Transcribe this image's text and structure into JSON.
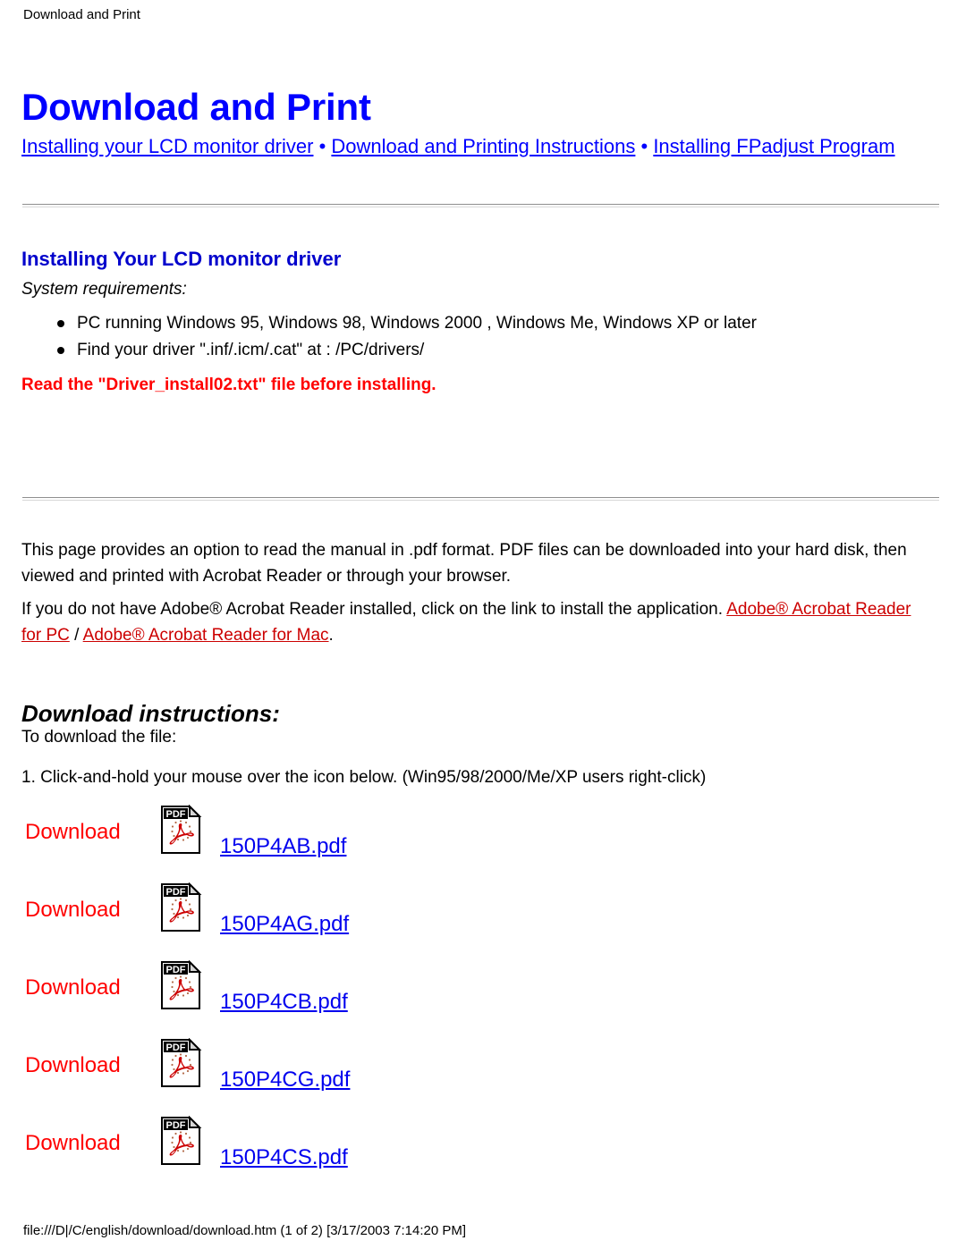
{
  "window": {
    "breadcrumb": "Download and Print"
  },
  "header": {
    "title": "Download and Print",
    "nav": {
      "link1": "Installing your LCD monitor driver",
      "sep1": " • ",
      "link2": "Download and Printing Instructions",
      "sep2": " • ",
      "link3": "Installing FPadjust Program"
    }
  },
  "driver_section": {
    "heading": "Installing Your LCD monitor driver",
    "sysreq_label": "System requirements:",
    "bullets": [
      "PC running Windows 95, Windows 98, Windows 2000 , Windows Me, Windows XP or later",
      "Find your driver \".inf/.icm/.cat\" at : /PC/drivers/"
    ],
    "warning": "Read the \"Driver_install02.txt\" file before installing."
  },
  "pdf_section": {
    "paragraph1": "This page provides an option to read the manual in .pdf format. PDF files can be downloaded into your hard disk, then viewed and printed with Acrobat Reader or through your browser.",
    "paragraph2_prefix": "If you do not have Adobe® Acrobat Reader installed, click on the link to install the application. ",
    "link_pc": "Adobe® Acrobat Reader for PC",
    "paragraph2_mid": " / ",
    "link_mac": "Adobe® Acrobat Reader for Mac",
    "paragraph2_suffix": "."
  },
  "download_section": {
    "heading": "Download instructions:",
    "subtitle": "To download the file:",
    "step1": "1. Click-and-hold your mouse over the icon below. (Win95/98/2000/Me/XP users right-click)",
    "rows": [
      {
        "label": "Download",
        "icon": "pdf-file-icon",
        "file": "150P4AB.pdf"
      },
      {
        "label": "Download",
        "icon": "pdf-file-icon",
        "file": "150P4AG.pdf"
      },
      {
        "label": "Download",
        "icon": "pdf-file-icon",
        "file": "150P4CB.pdf"
      },
      {
        "label": "Download",
        "icon": "pdf-file-icon",
        "file": "150P4CG.pdf"
      },
      {
        "label": "Download",
        "icon": "pdf-file-icon",
        "file": "150P4CS.pdf"
      }
    ]
  },
  "footer": {
    "status": "file:///D|/C/english/download/download.htm (1 of 2) [3/17/2003 7:14:20 PM]"
  },
  "colors": {
    "link_blue": "#0000ee",
    "title_blue": "#0000ff",
    "heading_blue": "#0000cc",
    "warning_red": "#ff0000",
    "adobe_link_red": "#cc0000",
    "download_red": "#ff0000",
    "rule_gray": "#8f8f8f"
  }
}
